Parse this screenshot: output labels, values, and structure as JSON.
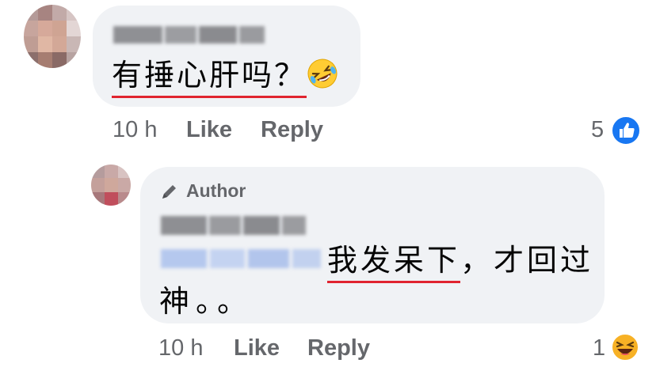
{
  "comment": {
    "text": "有捶心肝吗？",
    "emoji_icon": "rolling-on-floor-laughing-emoji",
    "time": "10 h",
    "like_label": "Like",
    "reply_label": "Reply",
    "reaction_count": "5",
    "reaction_icon": "like-icon"
  },
  "reply": {
    "author_badge": "Author",
    "author_badge_icon": "pencil-icon",
    "text_line1": "我发呆下，才回过",
    "text_line2": "神。。",
    "time": "10 h",
    "like_label": "Like",
    "reply_label": "Reply",
    "reaction_count": "1",
    "reaction_icon": "haha-icon"
  },
  "colors": {
    "bubble": "#f0f2f5",
    "meta_text": "#65676b",
    "underline": "#e0242f",
    "like_blue": "#1877f2",
    "haha_yellow": "#f7b125"
  }
}
